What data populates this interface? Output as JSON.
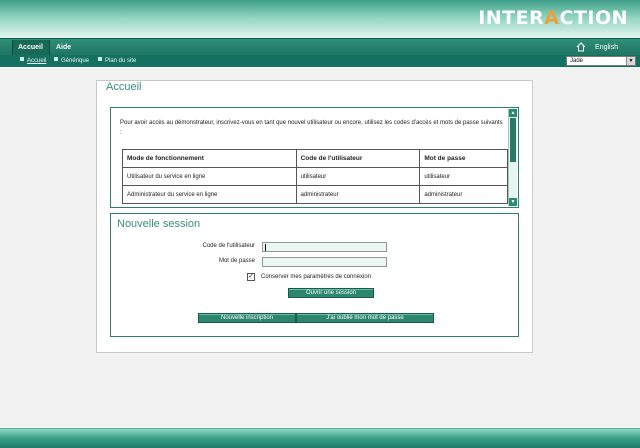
{
  "header": {
    "logo_text_1": "INTER",
    "logo_text_accent": "A",
    "logo_text_2": "CTION"
  },
  "nav": {
    "tabs": [
      {
        "label": "Accueil"
      },
      {
        "label": "Aide"
      }
    ],
    "language_label": "English",
    "home_icon": "home-icon"
  },
  "subnav": {
    "breadcrumbs": [
      {
        "label": "Accueil"
      },
      {
        "label": "Générique"
      },
      {
        "label": "Plan du site"
      }
    ],
    "theme_select": {
      "value": "Jade"
    }
  },
  "main": {
    "title": "Accueil",
    "intro": "Pour avoir accès au démonstrateur, inscrivez-vous en tant que nouvel utilisateur ou encore, utilisez les codes d'accès et mots de passe suivants :",
    "table": {
      "headers": [
        "Mode de fonctionnement",
        "Code de l'utilisateur",
        "Mot de passe"
      ],
      "rows": [
        [
          "Utilisateur du service en ligne",
          "utilisateur",
          "utilisateur"
        ],
        [
          "Administrateur du service en ligne",
          "administrateur",
          "administrateur"
        ]
      ]
    },
    "session": {
      "title": "Nouvelle session",
      "user_label": "Code de l'utilisateur",
      "user_value": "",
      "pass_label": "Mot de passe",
      "pass_value": "",
      "remember_label": "Conserver mes paramètres de connexion",
      "remember_checked": true,
      "open_button": "Ouvrir une session",
      "register_button": "Nouvelle inscription",
      "forgot_button": "J'ai oublié mon mot de passe"
    }
  },
  "colors": {
    "brand_green": "#2c8670",
    "title_teal": "#3a8f7f",
    "logo_accent": "#e8a040"
  }
}
